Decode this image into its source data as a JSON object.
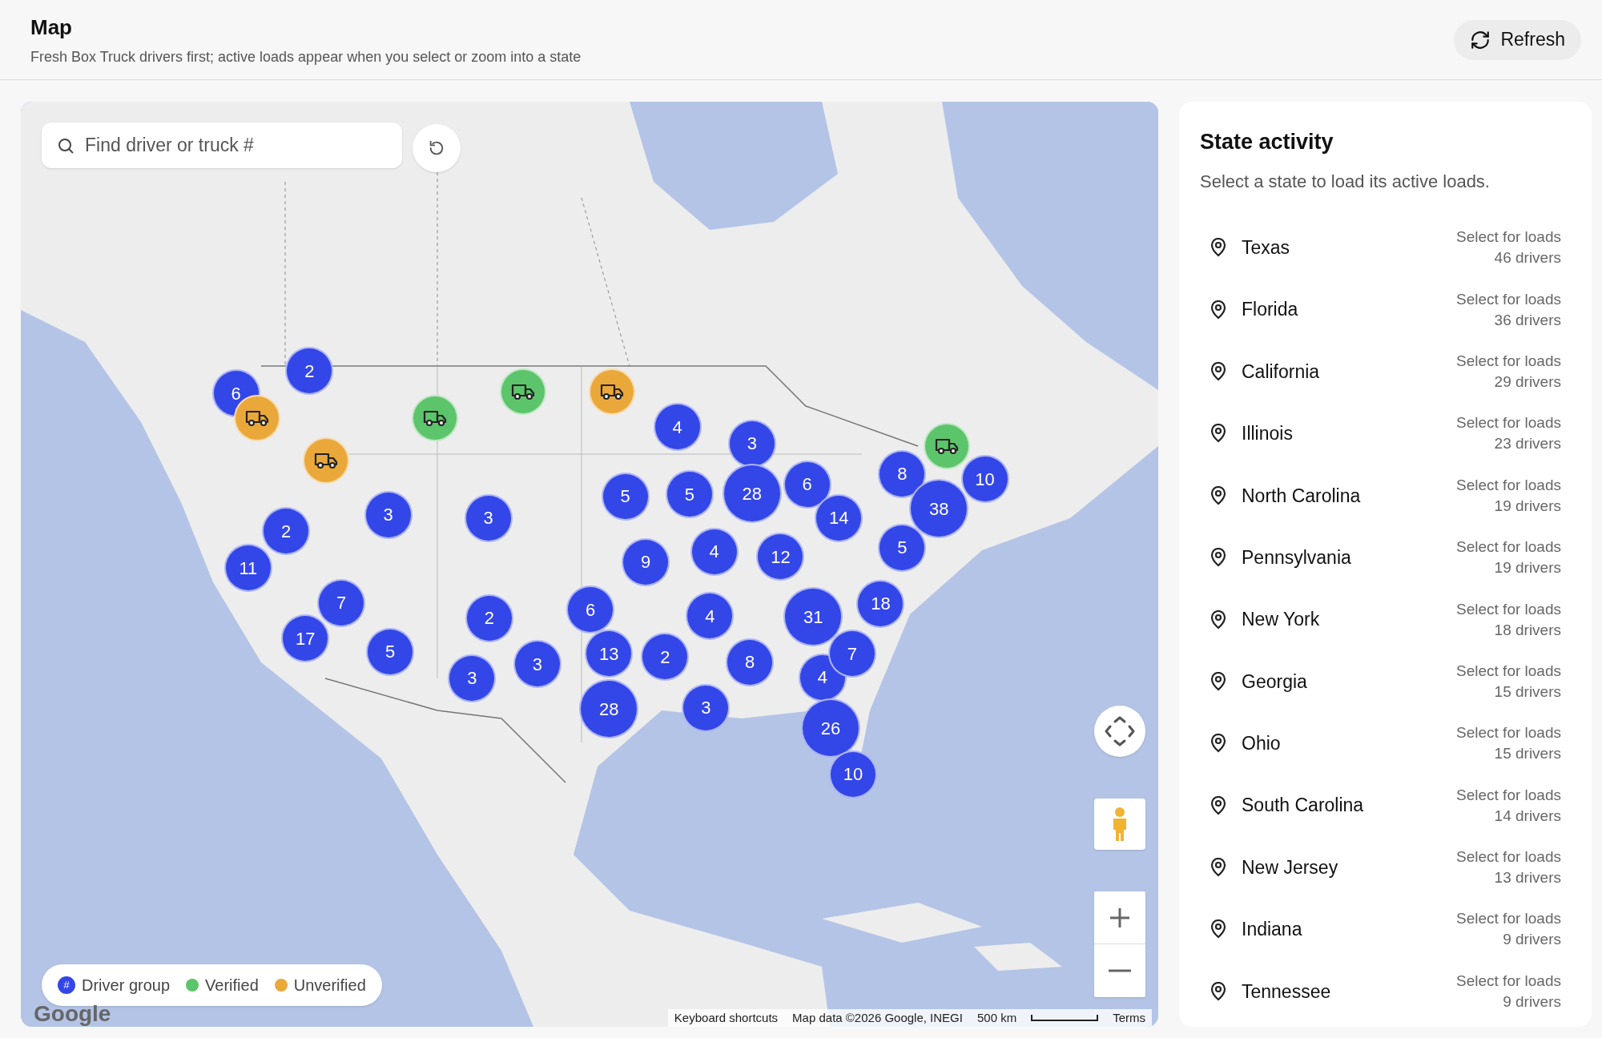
{
  "header": {
    "title": "Map",
    "subtitle": "Fresh Box Truck drivers first; active loads appear when you select or zoom into a state",
    "refresh_button": "Refresh"
  },
  "map": {
    "search": {
      "placeholder": "Find driver or truck #"
    },
    "markers": [
      {
        "kind": "group",
        "count": "6"
      },
      {
        "kind": "group",
        "count": "2"
      },
      {
        "kind": "verified"
      },
      {
        "kind": "unverified"
      },
      {
        "kind": "unverified"
      },
      {
        "kind": "verified"
      },
      {
        "kind": "group",
        "count": "4"
      },
      {
        "kind": "group",
        "count": "3"
      },
      {
        "kind": "verified"
      },
      {
        "kind": "unverified"
      },
      {
        "kind": "group",
        "count": "5"
      },
      {
        "kind": "group",
        "count": "5"
      },
      {
        "kind": "group",
        "count": "28"
      },
      {
        "kind": "group",
        "count": "6"
      },
      {
        "kind": "group",
        "count": "8"
      },
      {
        "kind": "group",
        "count": "10"
      },
      {
        "kind": "group",
        "count": "2"
      },
      {
        "kind": "group",
        "count": "3"
      },
      {
        "kind": "group",
        "count": "3"
      },
      {
        "kind": "group",
        "count": "14"
      },
      {
        "kind": "group",
        "count": "38"
      },
      {
        "kind": "group",
        "count": "11"
      },
      {
        "kind": "group",
        "count": "9"
      },
      {
        "kind": "group",
        "count": "4"
      },
      {
        "kind": "group",
        "count": "12"
      },
      {
        "kind": "group",
        "count": "5"
      },
      {
        "kind": "group",
        "count": "7"
      },
      {
        "kind": "group",
        "count": "2"
      },
      {
        "kind": "group",
        "count": "6"
      },
      {
        "kind": "group",
        "count": "4"
      },
      {
        "kind": "group",
        "count": "31"
      },
      {
        "kind": "group",
        "count": "18"
      },
      {
        "kind": "group",
        "count": "17"
      },
      {
        "kind": "group",
        "count": "5"
      },
      {
        "kind": "group",
        "count": "3"
      },
      {
        "kind": "group",
        "count": "3"
      },
      {
        "kind": "group",
        "count": "13"
      },
      {
        "kind": "group",
        "count": "2"
      },
      {
        "kind": "group",
        "count": "8"
      },
      {
        "kind": "group",
        "count": "4"
      },
      {
        "kind": "group",
        "count": "7"
      },
      {
        "kind": "group",
        "count": "28"
      },
      {
        "kind": "group",
        "count": "3"
      },
      {
        "kind": "group",
        "count": "26"
      },
      {
        "kind": "group",
        "count": "10"
      }
    ],
    "legend": [
      {
        "kind": "group",
        "label": "Driver group",
        "symbol": "#"
      },
      {
        "kind": "verified",
        "label": "Verified"
      },
      {
        "kind": "unverified",
        "label": "Unverified"
      }
    ],
    "logo": "Google",
    "attribution": [
      "Keyboard shortcuts",
      "Map data ©2026 Google, INEGI",
      "500 km",
      "Terms"
    ]
  },
  "state_activity": {
    "title": "State activity",
    "subtitle": "Select a state to load its active loads.",
    "states": [
      {
        "name": "Texas",
        "action": "Select for loads",
        "drivers": "46 drivers"
      },
      {
        "name": "Florida",
        "action": "Select for loads",
        "drivers": "36 drivers"
      },
      {
        "name": "California",
        "action": "Select for loads",
        "drivers": "29 drivers"
      },
      {
        "name": "Illinois",
        "action": "Select for loads",
        "drivers": "23 drivers"
      },
      {
        "name": "North Carolina",
        "action": "Select for loads",
        "drivers": "19 drivers"
      },
      {
        "name": "Pennsylvania",
        "action": "Select for loads",
        "drivers": "19 drivers"
      },
      {
        "name": "New York",
        "action": "Select for loads",
        "drivers": "18 drivers"
      },
      {
        "name": "Georgia",
        "action": "Select for loads",
        "drivers": "15 drivers"
      },
      {
        "name": "Ohio",
        "action": "Select for loads",
        "drivers": "15 drivers"
      },
      {
        "name": "South Carolina",
        "action": "Select for loads",
        "drivers": "14 drivers"
      },
      {
        "name": "New Jersey",
        "action": "Select for loads",
        "drivers": "13 drivers"
      },
      {
        "name": "Indiana",
        "action": "Select for loads",
        "drivers": "9 drivers"
      },
      {
        "name": "Tennessee",
        "action": "Select for loads",
        "drivers": "9 drivers"
      }
    ]
  }
}
